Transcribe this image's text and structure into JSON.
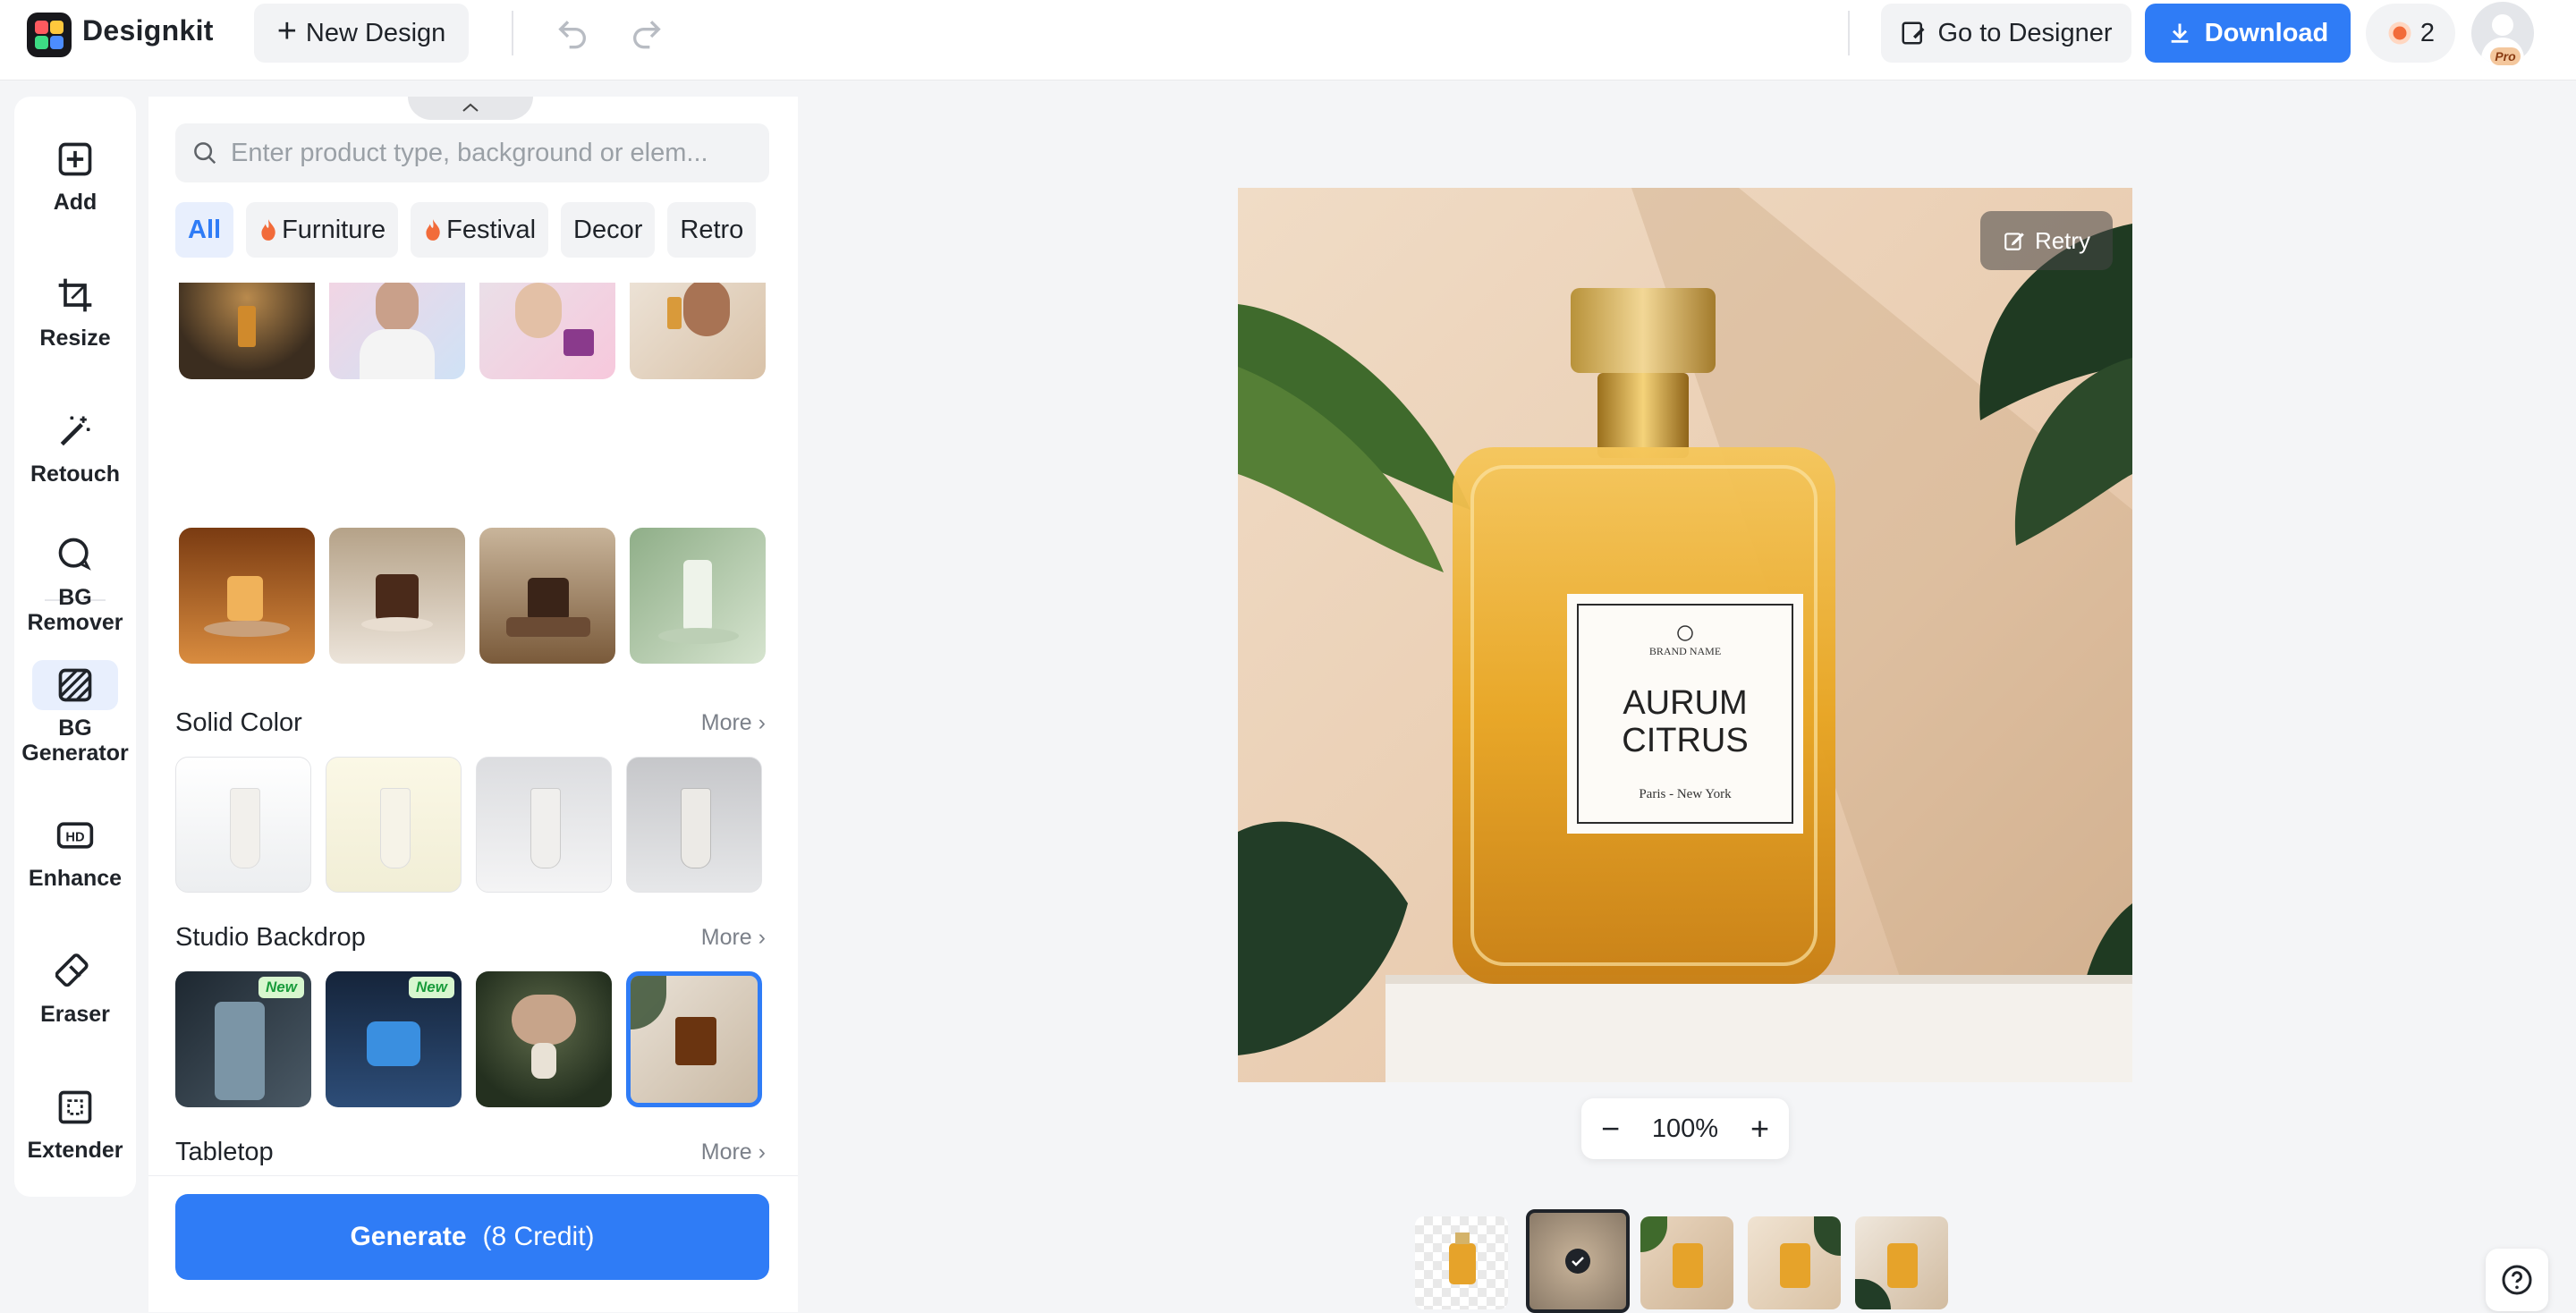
{
  "app": {
    "name": "Designkit",
    "new_design_label": "New Design",
    "go_to_designer_label": "Go to Designer",
    "download_label": "Download",
    "credits_count": "2",
    "pro_badge": "Pro"
  },
  "tools": [
    {
      "label": "Add",
      "icon": "add-square-icon"
    },
    {
      "label": "Resize",
      "icon": "crop-icon"
    },
    {
      "label": "Retouch",
      "icon": "magic-wand-icon"
    },
    {
      "label": "BG Remover",
      "icon": "bg-remover-icon"
    },
    {
      "label": "BG Generator",
      "icon": "bg-generator-icon",
      "active": true
    },
    {
      "label": "Enhance",
      "icon": "hd-icon"
    },
    {
      "label": "Eraser",
      "icon": "eraser-icon"
    },
    {
      "label": "Extender",
      "icon": "extender-icon"
    }
  ],
  "panel": {
    "search_placeholder": "Enter product type, background or elem...",
    "chips": [
      {
        "label": "All",
        "active": true
      },
      {
        "label": "Furniture",
        "hot": true
      },
      {
        "label": "Festival",
        "hot": true
      },
      {
        "label": "Decor"
      },
      {
        "label": "Retro"
      }
    ],
    "new_badge": "New",
    "sections": [
      {
        "title": "Solid Color",
        "more": "More"
      },
      {
        "title": "Studio Backdrop",
        "more": "More"
      },
      {
        "title": "Tabletop",
        "more": "More"
      }
    ],
    "generate_label": "Generate",
    "generate_cost": "(8 Credit)"
  },
  "canvas": {
    "retry_label": "Retry",
    "zoom_level": "100%",
    "label_text": {
      "brand": "BRAND NAME",
      "product_line1": "AURUM",
      "product_line2": "CITRUS",
      "cities": "Paris - New York"
    }
  },
  "colors": {
    "accent": "#2f7cf6",
    "background": "#f4f5f7",
    "new_badge_bg": "#d8f7cf",
    "new_badge_text": "#199b3b",
    "hot_icon": "#f26b3a"
  }
}
